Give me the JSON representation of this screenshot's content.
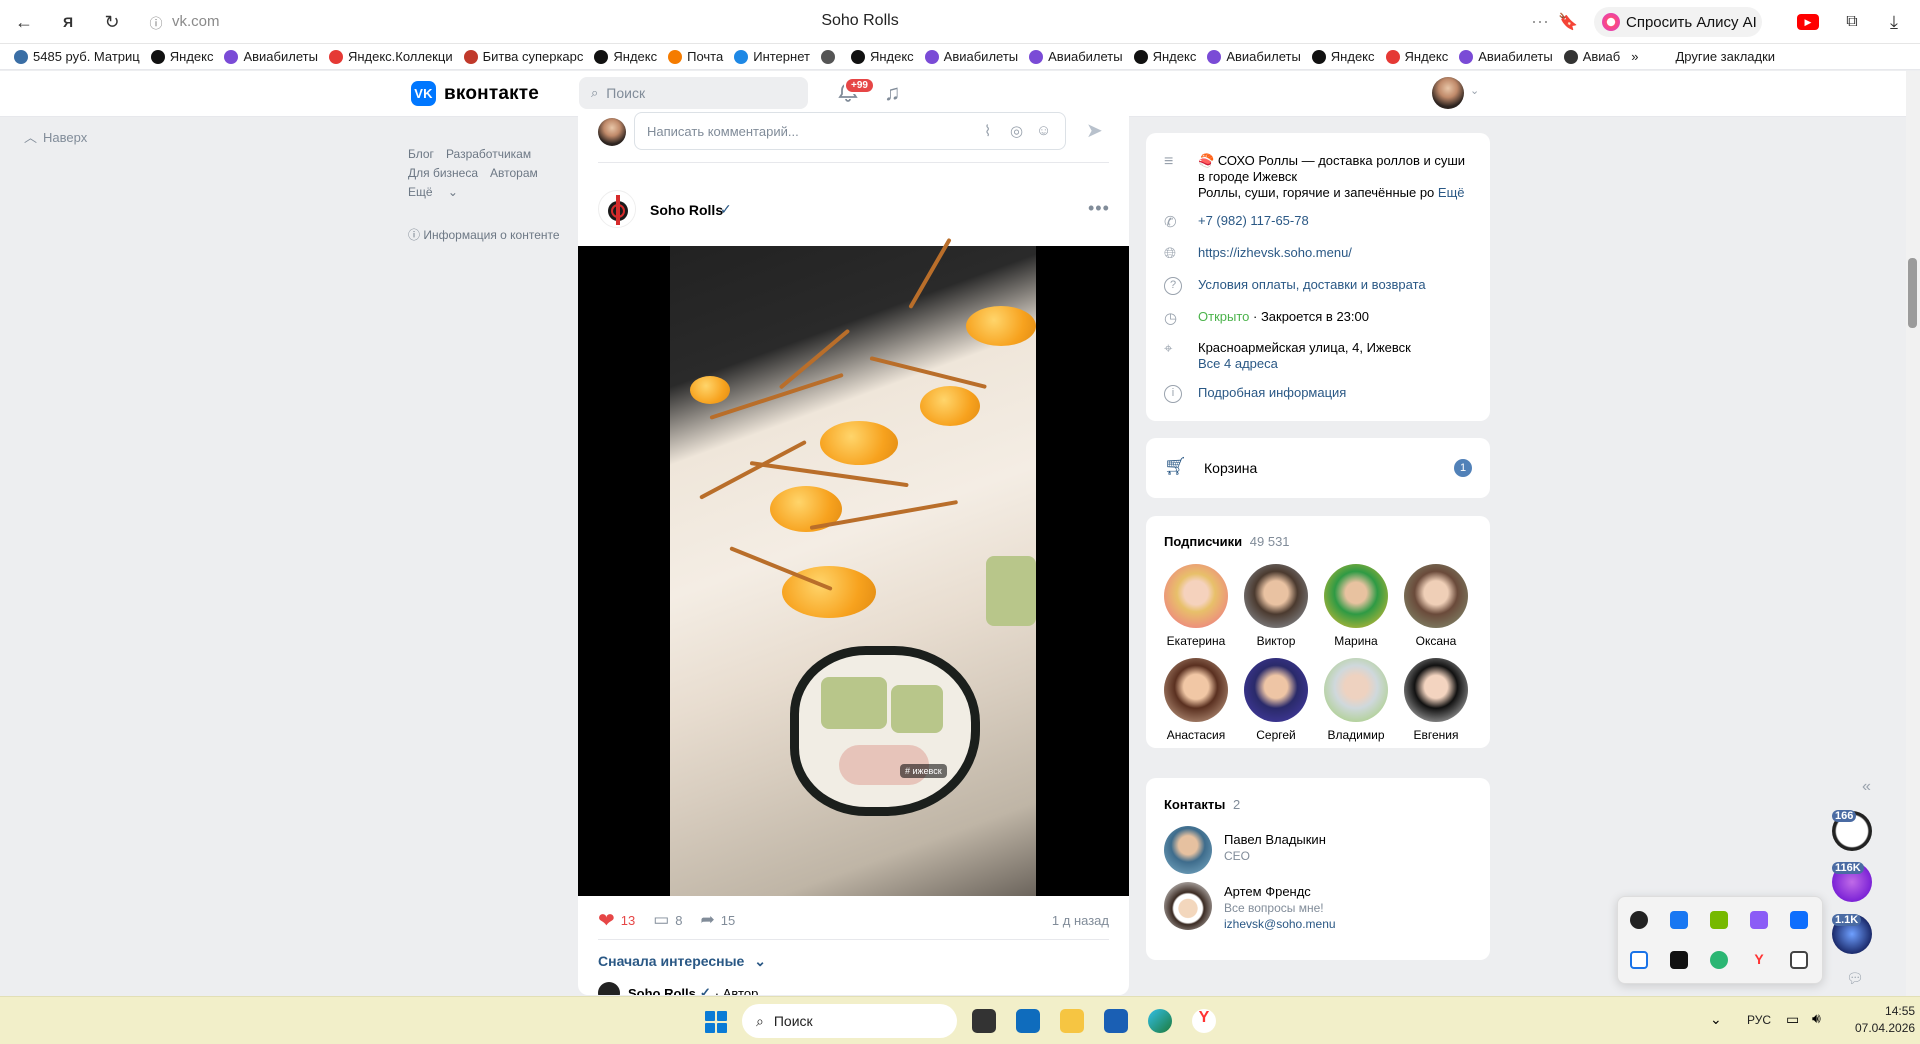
{
  "browser": {
    "url": "vk.com",
    "title": "Soho Rolls",
    "alice_label": "Спросить Алису AI",
    "bookmarks": [
      "5485 руб. Матриц",
      "Яндекс",
      "Авиабилеты",
      "Яндекс.Коллекци",
      "Битва суперкарс",
      "Яндекс",
      "Почта",
      "Интернет",
      "",
      "Яндекс",
      "Авиабилеты",
      "Авиабилеты",
      "Яндекс",
      "Авиабилеты",
      "Яндекс",
      "Яндекс",
      "Авиабилеты",
      "Авиаб"
    ],
    "more_bookmarks": "»",
    "other_bookmarks": "Другие закладки"
  },
  "vk": {
    "logo_text": "вконтакте",
    "search_placeholder": "Поиск",
    "notif_count": "+99"
  },
  "left": {
    "upward": "Наверх",
    "links_row1": [
      "Блог",
      "Разработчикам"
    ],
    "links_row2": [
      "Для бизнеса",
      "Авторам"
    ],
    "more": "Ещё",
    "content_info": "Информация о контенте"
  },
  "post": {
    "comment_placeholder": "Написать комментарий...",
    "author": "Soho Rolls",
    "verified": "✓",
    "video_hashtag": "# ижевск",
    "likes": "13",
    "comments": "8",
    "shares": "15",
    "time": "1 д назад",
    "sort_label": "Сначала интересные",
    "reply_author": "Soho Rolls",
    "reply_role": "· Автор"
  },
  "info": {
    "description_line1": "СОХО Роллы — доставка роллов и суши",
    "description_line2": "в городе Ижевск",
    "description_line3": "Роллы, суши, горячие и запечённые ро",
    "more": "Ещё",
    "phone": "+7 (982) 117-65-78",
    "website": "https://izhevsk.soho.menu/",
    "terms": "Условия оплаты, доставки и возврата",
    "open_status": "Открыто",
    "closes": "Закроется в 23:00",
    "address": "Красноармейская улица, 4, Ижевск",
    "all_addresses": "Все 4 адреса",
    "details": "Подробная информация"
  },
  "cart": {
    "label": "Корзина",
    "count": "1"
  },
  "subscribers": {
    "title": "Подписчики",
    "count": "49 531",
    "people": [
      "Екатерина",
      "Виктор",
      "Марина",
      "Оксана",
      "Анастасия",
      "Сергей",
      "Владимир",
      "Евгения"
    ]
  },
  "contacts": {
    "title": "Контакты",
    "count": "2",
    "people": [
      {
        "name": "Павел Владыкин",
        "role": "CEO"
      },
      {
        "name": "Артем Френдс",
        "role": "Все вопросы мне!",
        "email": "izhevsk@soho.menu"
      }
    ]
  },
  "floating": {
    "badges": [
      "166",
      "116K",
      "1.1K"
    ]
  },
  "taskbar": {
    "search_placeholder": "Поиск",
    "lang": "РУС",
    "time": "14:55",
    "date": "07.04.2026"
  }
}
